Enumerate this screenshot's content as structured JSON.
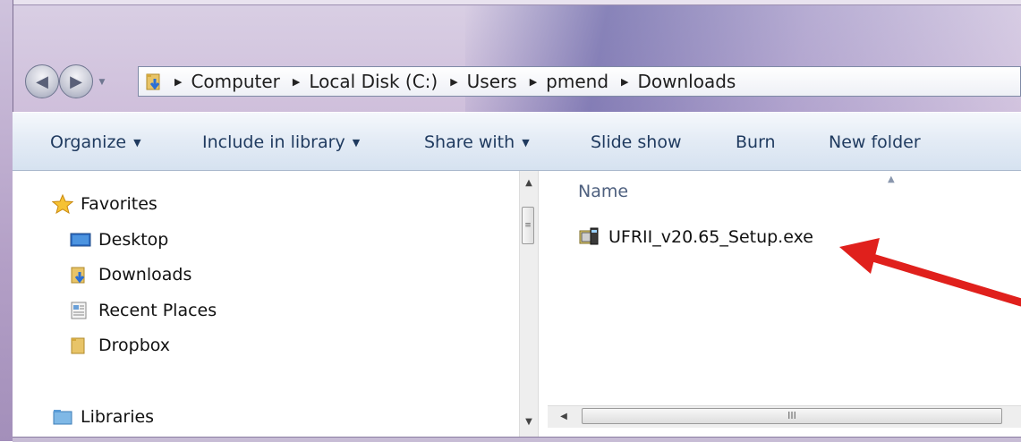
{
  "address_bar": {
    "crumbs": [
      "Computer",
      "Local Disk (C:)",
      "Users",
      "pmend",
      "Downloads"
    ]
  },
  "toolbar": {
    "organize": "Organize",
    "include_in_library": "Include in library",
    "share_with": "Share with",
    "slide_show": "Slide show",
    "burn": "Burn",
    "new_folder": "New folder"
  },
  "nav_pane": {
    "favorites": "Favorites",
    "items": [
      "Desktop",
      "Downloads",
      "Recent Places",
      "Dropbox"
    ],
    "libraries": "Libraries"
  },
  "file_list": {
    "column_name": "Name",
    "files": [
      "UFRII_v20.65_Setup.exe"
    ]
  },
  "annotation": {
    "arrow_color": "#e0201c"
  }
}
